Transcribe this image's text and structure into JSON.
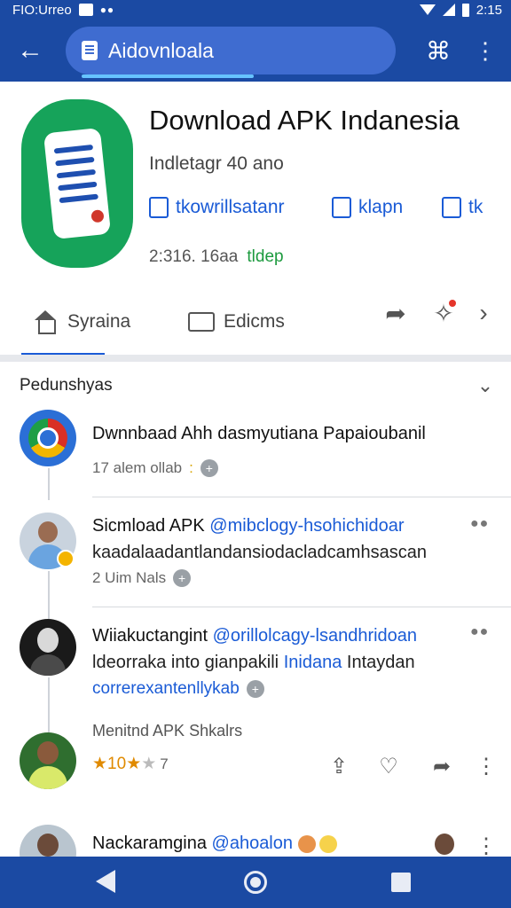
{
  "status_bar": {
    "left_text": "FIO:Urreo",
    "time": "2:15"
  },
  "browser": {
    "url_text": "Aidovnloala"
  },
  "app": {
    "title": "Download APK Indanesia",
    "subtitle": "Indletagr 40 ano",
    "actions": [
      "tkowrillsatanr",
      "klapn",
      "tk"
    ],
    "meta": "2:316. 16aa",
    "meta_green": "tldep"
  },
  "tabs": [
    "Syraina",
    "Edicms"
  ],
  "section": {
    "title": "Pedunshyas"
  },
  "comments": [
    {
      "title": "Dwnnbaad Ahh dasmyutiana Papaioubanil",
      "meta": "17 alem ollab",
      "meta_yellow": ":"
    },
    {
      "name": "Sicmload APK",
      "mention": "@mibclogy-hsohichidoar",
      "body": "kaadalaadantlandansiodacladcamhsascan",
      "meta": "2 Uim Nals"
    },
    {
      "name": "Wiiakuctangint",
      "mention": "@orillolcagy-lsandhridoan",
      "body_prefix": "ldeorraka into gianpakili",
      "body_link": "Inidana",
      "body_suffix": "Intaydan",
      "link_line": "correrexantenllykab"
    },
    {
      "caption": "Menitnd APK Shkalrs",
      "rating_value": "10",
      "rating_count": "7"
    },
    {
      "name": "Nackaramgina",
      "mention": "@ahoalon"
    }
  ],
  "icons": {
    "back": "arrow-left-icon",
    "tabs": "tab-switcher-icon",
    "more": "more-vertical-icon",
    "share": "share-icon",
    "like": "heart-icon"
  },
  "colors": {
    "primary": "#1b4aa3",
    "accent": "#1a5bd6",
    "app_icon": "#16a35a"
  }
}
